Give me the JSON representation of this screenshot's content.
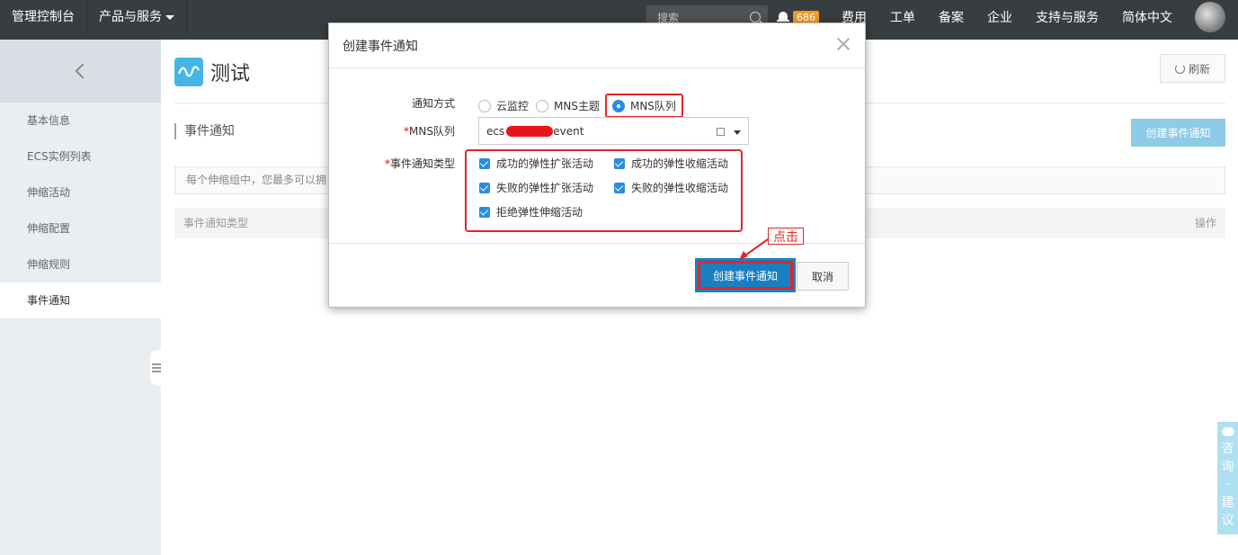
{
  "topbar": {
    "console": "管理控制台",
    "products": "产品与服务",
    "search_placeholder": "搜索",
    "notification_count": "686",
    "items": [
      "费用",
      "工单",
      "备案",
      "企业",
      "支持与服务",
      "简体中文"
    ]
  },
  "sidebar": {
    "items": [
      {
        "label": "基本信息"
      },
      {
        "label": "ECS实例列表"
      },
      {
        "label": "伸缩活动"
      },
      {
        "label": "伸缩配置"
      },
      {
        "label": "伸缩规则"
      },
      {
        "label": "事件通知"
      }
    ],
    "active_index": 5
  },
  "main": {
    "title": "测试",
    "refresh": "刷新",
    "section_title": "事件通知",
    "create_button": "创建事件通知",
    "notice": "每个伸缩组中，您最多可以拥",
    "table_headers": {
      "type": "事件通知类型",
      "actions": "操作"
    }
  },
  "feedback": {
    "chars": [
      "咨",
      "询",
      "·",
      "建",
      "议"
    ]
  },
  "modal": {
    "title": "创建事件通知",
    "method_label": "通知方式",
    "methods": [
      {
        "label": "云监控",
        "checked": false
      },
      {
        "label": "MNS主题",
        "checked": false
      },
      {
        "label": "MNS队列",
        "checked": true
      }
    ],
    "queue_label": "MNS队列",
    "queue_value_prefix": "ecs",
    "queue_value_suffix": "event",
    "types_label": "事件通知类型",
    "types": [
      {
        "label": "成功的弹性扩张活动",
        "checked": true
      },
      {
        "label": "成功的弹性收缩活动",
        "checked": true
      },
      {
        "label": "失败的弹性扩张活动",
        "checked": true
      },
      {
        "label": "失败的弹性收缩活动",
        "checked": true
      },
      {
        "label": "拒绝弹性伸缩活动",
        "checked": true
      }
    ],
    "submit": "创建事件通知",
    "cancel": "取消"
  },
  "annotation": {
    "click_label": "点击"
  },
  "colors": {
    "accent": "#1a7fc1",
    "highlight": "#e0262a",
    "topbar": "#373d41"
  }
}
